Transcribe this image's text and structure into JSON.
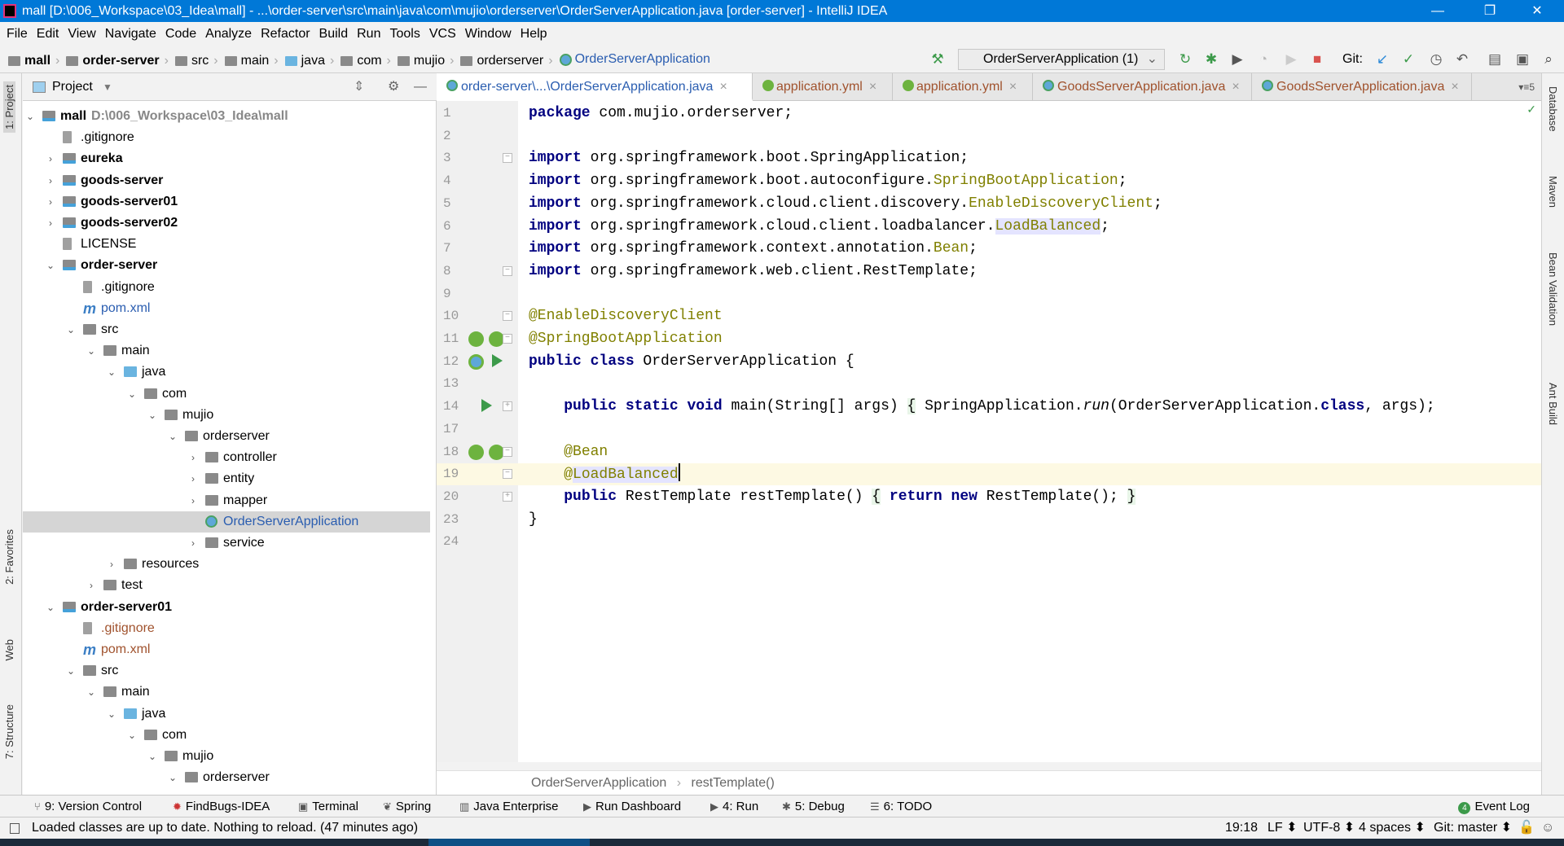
{
  "title": "mall [D:\\006_Workspace\\03_Idea\\mall] - ...\\order-server\\src\\main\\java\\com\\mujio\\orderserver\\OrderServerApplication.java [order-server] - IntelliJ IDEA",
  "window_controls": {
    "minimize": "—",
    "restore": "❐",
    "close": "✕"
  },
  "menu": [
    "File",
    "Edit",
    "View",
    "Navigate",
    "Code",
    "Analyze",
    "Refactor",
    "Build",
    "Run",
    "Tools",
    "VCS",
    "Window",
    "Help"
  ],
  "breadcrumbs": [
    "mall",
    "order-server",
    "src",
    "main",
    "java",
    "com",
    "mujio",
    "orderserver",
    "OrderServerApplication"
  ],
  "run_config": "OrderServerApplication (1)",
  "git_label": "Git:",
  "project_panel": {
    "title": "Project"
  },
  "tree": [
    {
      "label": "mall",
      "path": "D:\\006_Workspace\\03_Idea\\mall",
      "level": 0,
      "arrow": "open",
      "icon": "module",
      "bold": true
    },
    {
      "label": ".gitignore",
      "level": 1,
      "icon": "file"
    },
    {
      "label": "eureka",
      "level": 1,
      "arrow": "closed",
      "icon": "module",
      "bold": true
    },
    {
      "label": "goods-server",
      "level": 1,
      "arrow": "closed",
      "icon": "module",
      "bold": true
    },
    {
      "label": "goods-server01",
      "level": 1,
      "arrow": "closed",
      "icon": "module",
      "bold": true
    },
    {
      "label": "goods-server02",
      "level": 1,
      "arrow": "closed",
      "icon": "module",
      "bold": true
    },
    {
      "label": "LICENSE",
      "level": 1,
      "icon": "file"
    },
    {
      "label": "order-server",
      "level": 1,
      "arrow": "open",
      "icon": "module",
      "bold": true
    },
    {
      "label": ".gitignore",
      "level": 2,
      "icon": "file"
    },
    {
      "label": "pom.xml",
      "level": 2,
      "icon": "maven",
      "color": "#2a5db0"
    },
    {
      "label": "src",
      "level": 2,
      "arrow": "open",
      "icon": "folder"
    },
    {
      "label": "main",
      "level": 3,
      "arrow": "open",
      "icon": "folder"
    },
    {
      "label": "java",
      "level": 4,
      "arrow": "open",
      "icon": "source"
    },
    {
      "label": "com",
      "level": 5,
      "arrow": "open",
      "icon": "folder"
    },
    {
      "label": "mujio",
      "level": 6,
      "arrow": "open",
      "icon": "folder"
    },
    {
      "label": "orderserver",
      "level": 7,
      "arrow": "open",
      "icon": "folder"
    },
    {
      "label": "controller",
      "level": 8,
      "arrow": "closed",
      "icon": "folder"
    },
    {
      "label": "entity",
      "level": 8,
      "arrow": "closed",
      "icon": "folder"
    },
    {
      "label": "mapper",
      "level": 8,
      "arrow": "closed",
      "icon": "folder"
    },
    {
      "label": "OrderServerApplication",
      "level": 8,
      "icon": "class",
      "selected": true,
      "color": "#2a5db0"
    },
    {
      "label": "service",
      "level": 8,
      "arrow": "closed",
      "icon": "folder"
    },
    {
      "label": "resources",
      "level": 4,
      "arrow": "closed",
      "icon": "folder"
    },
    {
      "label": "test",
      "level": 3,
      "arrow": "closed",
      "icon": "folder"
    },
    {
      "label": "order-server01",
      "level": 1,
      "arrow": "open",
      "icon": "module",
      "bold": true
    },
    {
      "label": ".gitignore",
      "level": 2,
      "icon": "file",
      "color": "#a0522d"
    },
    {
      "label": "pom.xml",
      "level": 2,
      "icon": "maven",
      "color": "#a0522d"
    },
    {
      "label": "src",
      "level": 2,
      "arrow": "open",
      "icon": "folder"
    },
    {
      "label": "main",
      "level": 3,
      "arrow": "open",
      "icon": "folder"
    },
    {
      "label": "java",
      "level": 4,
      "arrow": "open",
      "icon": "source"
    },
    {
      "label": "com",
      "level": 5,
      "arrow": "open",
      "icon": "folder"
    },
    {
      "label": "mujio",
      "level": 6,
      "arrow": "open",
      "icon": "folder"
    },
    {
      "label": "orderserver",
      "level": 7,
      "arrow": "open",
      "icon": "folder"
    }
  ],
  "tabs": [
    {
      "label": "order-server\\...\\OrderServerApplication.java",
      "icon": "java-class",
      "active": true
    },
    {
      "label": "application.yml",
      "icon": "spring",
      "color": "#a0522d"
    },
    {
      "label": "application.yml",
      "icon": "spring",
      "color": "#a0522d"
    },
    {
      "label": "GoodsServerApplication.java",
      "icon": "java-class",
      "color": "#a0522d"
    },
    {
      "label": "GoodsServerApplication.java",
      "icon": "java-class",
      "color": "#a0522d"
    }
  ],
  "tabs_overflow": "▾≡5",
  "code": [
    {
      "n": "1",
      "seg": [
        [
          "kw",
          "package"
        ],
        [
          "id",
          " com.mujio.orderserver;"
        ]
      ]
    },
    {
      "n": "2",
      "seg": []
    },
    {
      "n": "3",
      "seg": [
        [
          "kw",
          "import"
        ],
        [
          "id",
          " org.springframework.boot.SpringApplication;"
        ]
      ]
    },
    {
      "n": "4",
      "seg": [
        [
          "kw",
          "import"
        ],
        [
          "id",
          " org.springframework.boot.autoconfigure."
        ],
        [
          "an",
          "SpringBootApplication"
        ],
        [
          "id",
          ";"
        ]
      ]
    },
    {
      "n": "5",
      "seg": [
        [
          "kw",
          "import"
        ],
        [
          "id",
          " org.springframework.cloud.client.discovery."
        ],
        [
          "an",
          "EnableDiscoveryClient"
        ],
        [
          "id",
          ";"
        ]
      ]
    },
    {
      "n": "6",
      "seg": [
        [
          "kw",
          "import"
        ],
        [
          "id",
          " org.springframework.cloud.client.loadbalancer."
        ],
        [
          "an hl",
          "LoadBalanced"
        ],
        [
          "id",
          ";"
        ]
      ]
    },
    {
      "n": "7",
      "seg": [
        [
          "kw",
          "import"
        ],
        [
          "id",
          " org.springframework.context.annotation."
        ],
        [
          "an",
          "Bean"
        ],
        [
          "id",
          ";"
        ]
      ]
    },
    {
      "n": "8",
      "seg": [
        [
          "kw",
          "import"
        ],
        [
          "id",
          " org.springframework.web.client.RestTemplate;"
        ]
      ]
    },
    {
      "n": "9",
      "seg": []
    },
    {
      "n": "10",
      "seg": [
        [
          "an",
          "@EnableDiscoveryClient"
        ]
      ]
    },
    {
      "n": "11",
      "seg": [
        [
          "an",
          "@SpringBootApplication"
        ]
      ]
    },
    {
      "n": "12",
      "seg": [
        [
          "kw",
          "public class"
        ],
        [
          "id",
          " OrderServerApplication {"
        ]
      ]
    },
    {
      "n": "13",
      "seg": []
    },
    {
      "n": "14",
      "seg": [
        [
          "id",
          "    "
        ],
        [
          "kw",
          "public static void"
        ],
        [
          "id",
          " main(String[] args) "
        ],
        [
          "br",
          "{"
        ],
        [
          "id",
          " SpringApplication."
        ],
        [
          "it",
          "run"
        ],
        [
          "id",
          "(OrderServerApplication."
        ],
        [
          "kw",
          "class"
        ],
        [
          "id",
          ", args); "
        ]
      ]
    },
    {
      "n": "17",
      "seg": []
    },
    {
      "n": "18",
      "seg": [
        [
          "id",
          "    "
        ],
        [
          "an",
          "@Bean"
        ]
      ]
    },
    {
      "n": "19",
      "seg": [
        [
          "id",
          "    "
        ],
        [
          "an",
          "@"
        ],
        [
          "an hl",
          "LoadBalanced"
        ]
      ],
      "current": true
    },
    {
      "n": "20",
      "seg": [
        [
          "id",
          "    "
        ],
        [
          "kw",
          "public"
        ],
        [
          "id",
          " RestTemplate restTemplate() "
        ],
        [
          "br",
          "{"
        ],
        [
          "id",
          " "
        ],
        [
          "kw",
          "return new"
        ],
        [
          "id",
          " RestTemplate(); "
        ],
        [
          "br",
          "}"
        ]
      ]
    },
    {
      "n": "23",
      "seg": [
        [
          "id",
          "}"
        ]
      ]
    },
    {
      "n": "24",
      "seg": []
    }
  ],
  "editor_breadcrumb": [
    "OrderServerApplication",
    "restTemplate()"
  ],
  "tool_windows": [
    "9: Version Control",
    "FindBugs-IDEA",
    "Terminal",
    "Spring",
    "Java Enterprise",
    "Run Dashboard",
    "4: Run",
    "5: Debug",
    "6: TODO"
  ],
  "event_log": {
    "label": "Event Log",
    "count": "4"
  },
  "left_tabs": [
    "1: Project",
    "2: Favorites",
    "Web",
    "7: Structure"
  ],
  "right_tabs": [
    "Database",
    "Maven",
    "Bean Validation",
    "Ant Build"
  ],
  "status": {
    "message": "Loaded classes are up to date. Nothing to reload. (47 minutes ago)",
    "position": "19:18",
    "line_sep": "LF ⬍",
    "encoding": "UTF-8 ⬍",
    "indent": "4 spaces ⬍",
    "git": "Git: master ⬍"
  }
}
